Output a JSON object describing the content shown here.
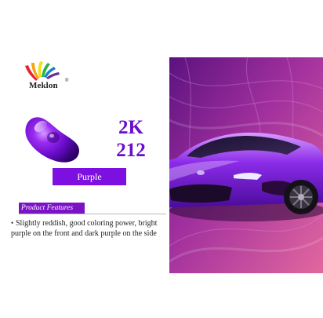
{
  "brand": {
    "name": "Meklon",
    "registered_mark": "®",
    "logo_colors": [
      "#e8242c",
      "#f7a21b",
      "#f2e01c",
      "#2db34a",
      "#1c7fd1",
      "#6a2d91"
    ]
  },
  "product": {
    "code_line1": "2K",
    "code_line2": "212",
    "color_name": "Purple",
    "accent_color": "#7d10e0"
  },
  "features": {
    "title": "Product Features",
    "bullet": "•",
    "description": "Slightly reddish, good coloring power, bright purple on the front and dark purple on the side"
  },
  "images": {
    "swatch_icon": "paint-swatch-icon",
    "car_photo": "purple-sports-car-photo"
  }
}
